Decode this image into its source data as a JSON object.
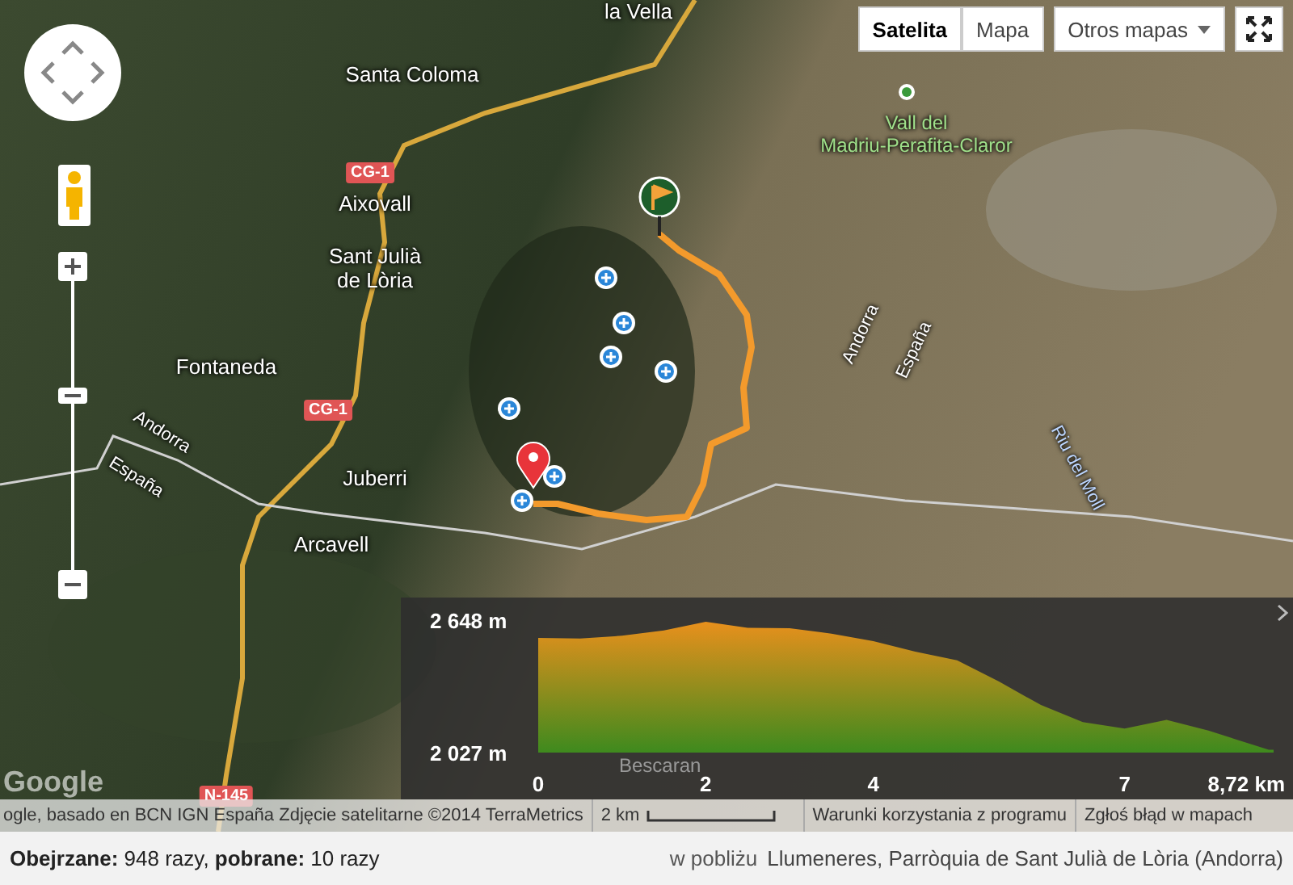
{
  "map_type_buttons": [
    {
      "label": "Satelita",
      "selected": true,
      "kind": "button"
    },
    {
      "label": "Mapa",
      "selected": false,
      "kind": "button"
    },
    {
      "label": "Otros mapas",
      "selected": false,
      "kind": "dropdown"
    }
  ],
  "map_labels": [
    {
      "text": "la Vella",
      "kind": "place"
    },
    {
      "text": "Santa Coloma",
      "kind": "place"
    },
    {
      "text": "Aixovall",
      "kind": "place"
    },
    {
      "text": "Sant Julià\nde Lòria",
      "kind": "place"
    },
    {
      "text": "Fontaneda",
      "kind": "place"
    },
    {
      "text": "Juberri",
      "kind": "place"
    },
    {
      "text": "Arcavell",
      "kind": "place"
    },
    {
      "text": "Andorra",
      "kind": "border"
    },
    {
      "text": "España",
      "kind": "border"
    },
    {
      "text": "Andorra",
      "kind": "border"
    },
    {
      "text": "España",
      "kind": "border"
    },
    {
      "text": "Vall del\nMadriu-Perafita-Claror",
      "kind": "park"
    },
    {
      "text": "Riu del Moll",
      "kind": "water"
    },
    {
      "text": "CG-1",
      "kind": "road"
    },
    {
      "text": "CG-1",
      "kind": "road"
    },
    {
      "text": "N-145",
      "kind": "road"
    }
  ],
  "elevation_profile": {
    "overlay_label": "Bescaran",
    "chart_data": {
      "type": "area",
      "x": [
        0,
        0.5,
        1,
        1.5,
        2,
        2.5,
        3,
        3.5,
        4,
        4.5,
        5,
        5.5,
        6,
        6.5,
        7,
        7.5,
        8,
        8.72
      ],
      "series": [
        {
          "color": "#e8901c",
          "values": [
            2565,
            2562,
            2575,
            2600,
            2640,
            2612,
            2610,
            2585,
            2550,
            2500,
            2460,
            2360,
            2250,
            2170,
            2140,
            2180,
            2130,
            2040
          ]
        }
      ],
      "xlim": [
        0,
        8.72
      ],
      "ylim": [
        2027,
        2648
      ],
      "xticks": [
        0,
        2,
        4,
        7,
        {
          "value": 8.72,
          "label": "8,72 km"
        }
      ],
      "yticks": [
        {
          "value": 2648,
          "label": "2 648 m"
        },
        {
          "value": 2027,
          "label": "2 027 m"
        }
      ]
    }
  },
  "attribution": {
    "logo": "Google",
    "data_credit": "ogle, basado en BCN IGN España Zdjęcie satelitarne ©2014 TerraMetrics",
    "scale": "2 km",
    "terms_link": "Warunki korzystania z programu",
    "report_link": "Zgłoś błąd w mapach"
  },
  "footer": {
    "stats": "**Obejrzane:** 948 razy, **pobrane:** 10 razy",
    "near_label": "w pobliżu",
    "location": "Llumeneres, Parròquia de Sant Julià de Lòria (Andorra)"
  }
}
